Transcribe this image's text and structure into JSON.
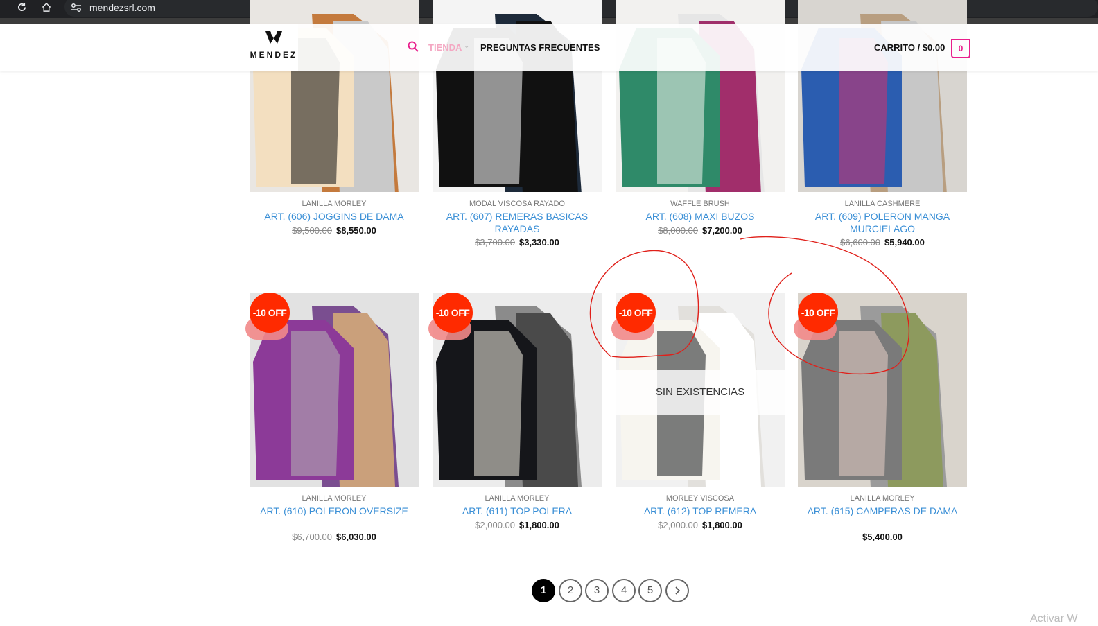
{
  "browser": {
    "url": "mendezsrl.com",
    "icons": [
      "back-icon",
      "reload-icon",
      "home-icon",
      "site-settings-icon"
    ]
  },
  "header": {
    "logo_text": "MENDEZ",
    "nav": {
      "tienda": "TIENDA",
      "faq": "PREGUNTAS FRECUENTES"
    },
    "cart": {
      "label": "CARRITO / $0.00",
      "count": "0"
    },
    "accent_color": "#e91e8c"
  },
  "products": [
    {
      "category": "LANILLA MORLEY",
      "title": "ART. (606) JOGGINS DE DAMA",
      "old_price": "$9,500.00",
      "price": "$8,550.00"
    },
    {
      "category": "MODAL VISCOSA RAYADO",
      "title": "ART. (607) REMERAS BASICAS RAYADAS",
      "old_price": "$3,700.00",
      "price": "$3,330.00"
    },
    {
      "category": "WAFFLE BRUSH",
      "title": "ART. (608) MAXI BUZOS",
      "old_price": "$8,000.00",
      "price": "$7,200.00"
    },
    {
      "category": "LANILLA CASHMERE",
      "title": "ART. (609) POLERON MANGA MURCIELAGO",
      "old_price": "$6,600.00",
      "price": "$5,940.00"
    },
    {
      "category": "LANILLA MORLEY",
      "title": "ART. (610) POLERON OVERSIZE",
      "old_price": "$6,700.00",
      "price": "$6,030.00",
      "badge": "-10 OFF"
    },
    {
      "category": "LANILLA MORLEY",
      "title": "ART. (611) TOP POLERA",
      "old_price": "$2,000.00",
      "price": "$1,800.00",
      "badge": "-10 OFF"
    },
    {
      "category": "MORLEY VISCOSA",
      "title": "ART. (612) TOP REMERA",
      "old_price": "$2,000.00",
      "price": "$1,800.00",
      "badge": "-10 OFF",
      "overlay": "SIN EXISTENCIAS"
    },
    {
      "category": "LANILLA MORLEY",
      "title": "ART. (615) CAMPERAS DE DAMA",
      "old_price": "",
      "price": "$5,400.00",
      "badge": "-10 OFF"
    }
  ],
  "pagination": {
    "pages": [
      "1",
      "2",
      "3",
      "4",
      "5"
    ],
    "current": "1",
    "next_icon": "chevron-right-icon"
  },
  "annotation_color": "#e0201a"
}
